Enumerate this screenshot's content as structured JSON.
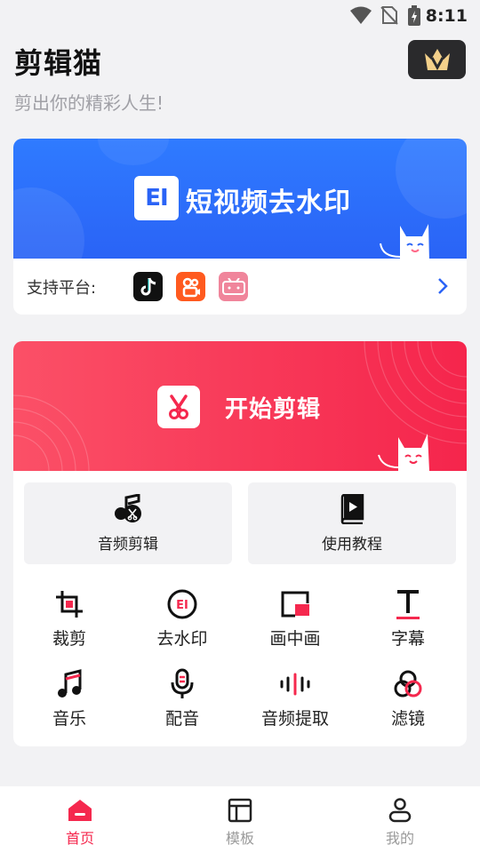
{
  "status_bar": {
    "time": "8:11"
  },
  "header": {
    "title": "剪辑猫",
    "subtitle": "剪出你的精彩人生!",
    "vip_icon": "crown-v-icon"
  },
  "watermark_card": {
    "banner_text": "短视频去水印",
    "logo_text": "EI",
    "platforms_label": "支持平台:",
    "platforms": [
      {
        "name": "tiktok-icon",
        "color": "#111111"
      },
      {
        "name": "kuaishou-icon",
        "color": "#ff5a1f"
      },
      {
        "name": "bilibili-icon",
        "color": "#f0859b"
      }
    ]
  },
  "edit_card": {
    "banner_text": "开始剪辑",
    "big_buttons": [
      {
        "label": "音频剪辑",
        "icon": "audio-scissor-icon"
      },
      {
        "label": "使用教程",
        "icon": "tutorial-book-icon"
      }
    ],
    "tools": [
      {
        "label": "裁剪",
        "icon": "crop-icon"
      },
      {
        "label": "去水印",
        "icon": "remove-watermark-icon"
      },
      {
        "label": "画中画",
        "icon": "picture-in-picture-icon"
      },
      {
        "label": "字幕",
        "icon": "subtitle-icon"
      },
      {
        "label": "音乐",
        "icon": "music-icon"
      },
      {
        "label": "配音",
        "icon": "microphone-icon"
      },
      {
        "label": "音频提取",
        "icon": "audio-extract-icon"
      },
      {
        "label": "滤镜",
        "icon": "filter-icon"
      }
    ]
  },
  "tab_bar": {
    "tabs": [
      {
        "label": "首页",
        "icon": "home-icon",
        "active": true
      },
      {
        "label": "模板",
        "icon": "template-icon",
        "active": false
      },
      {
        "label": "我的",
        "icon": "profile-icon",
        "active": false
      }
    ]
  },
  "colors": {
    "accent_red": "#f5284e",
    "banner_blue": "#2a63f6",
    "text_muted": "#a0a0a6"
  }
}
